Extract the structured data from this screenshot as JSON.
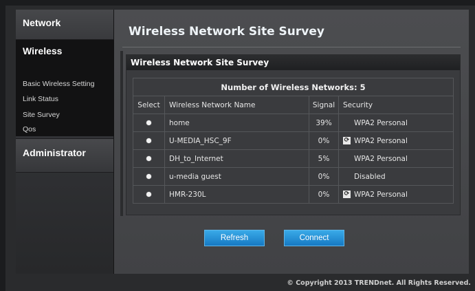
{
  "sidebar": {
    "network": "Network",
    "wireless": "Wireless",
    "items": [
      {
        "label": "Basic Wireless Setting"
      },
      {
        "label": "Link Status"
      },
      {
        "label": "Site Survey"
      },
      {
        "label": "Qos"
      }
    ],
    "administrator": "Administrator"
  },
  "page": {
    "title": "Wireless Network Site Survey",
    "panel_title": "Wireless Network Site Survey",
    "count_label": "Number of Wireless Networks: 5"
  },
  "table": {
    "headers": [
      "Select",
      "Wireless Network Name",
      "Signal",
      "Security"
    ],
    "rows": [
      {
        "name": "home",
        "signal": "39%",
        "security": "WPA2 Personal",
        "wps": false
      },
      {
        "name": "U-MEDIA_HSC_9F",
        "signal": "0%",
        "security": "WPA2 Personal",
        "wps": true
      },
      {
        "name": "DH_to_Internet",
        "signal": "5%",
        "security": "WPA2 Personal",
        "wps": false
      },
      {
        "name": "u-media guest",
        "signal": "0%",
        "security": "Disabled",
        "wps": false
      },
      {
        "name": "HMR-230L",
        "signal": "0%",
        "security": "WPA2 Personal",
        "wps": true
      }
    ]
  },
  "buttons": {
    "refresh": "Refresh",
    "connect": "Connect"
  },
  "footer": "© Copyright 2013 TRENDnet. All Rights Reserved.",
  "colors": {
    "button_accent": "#1e8ad6",
    "background": "#4c4d50"
  }
}
